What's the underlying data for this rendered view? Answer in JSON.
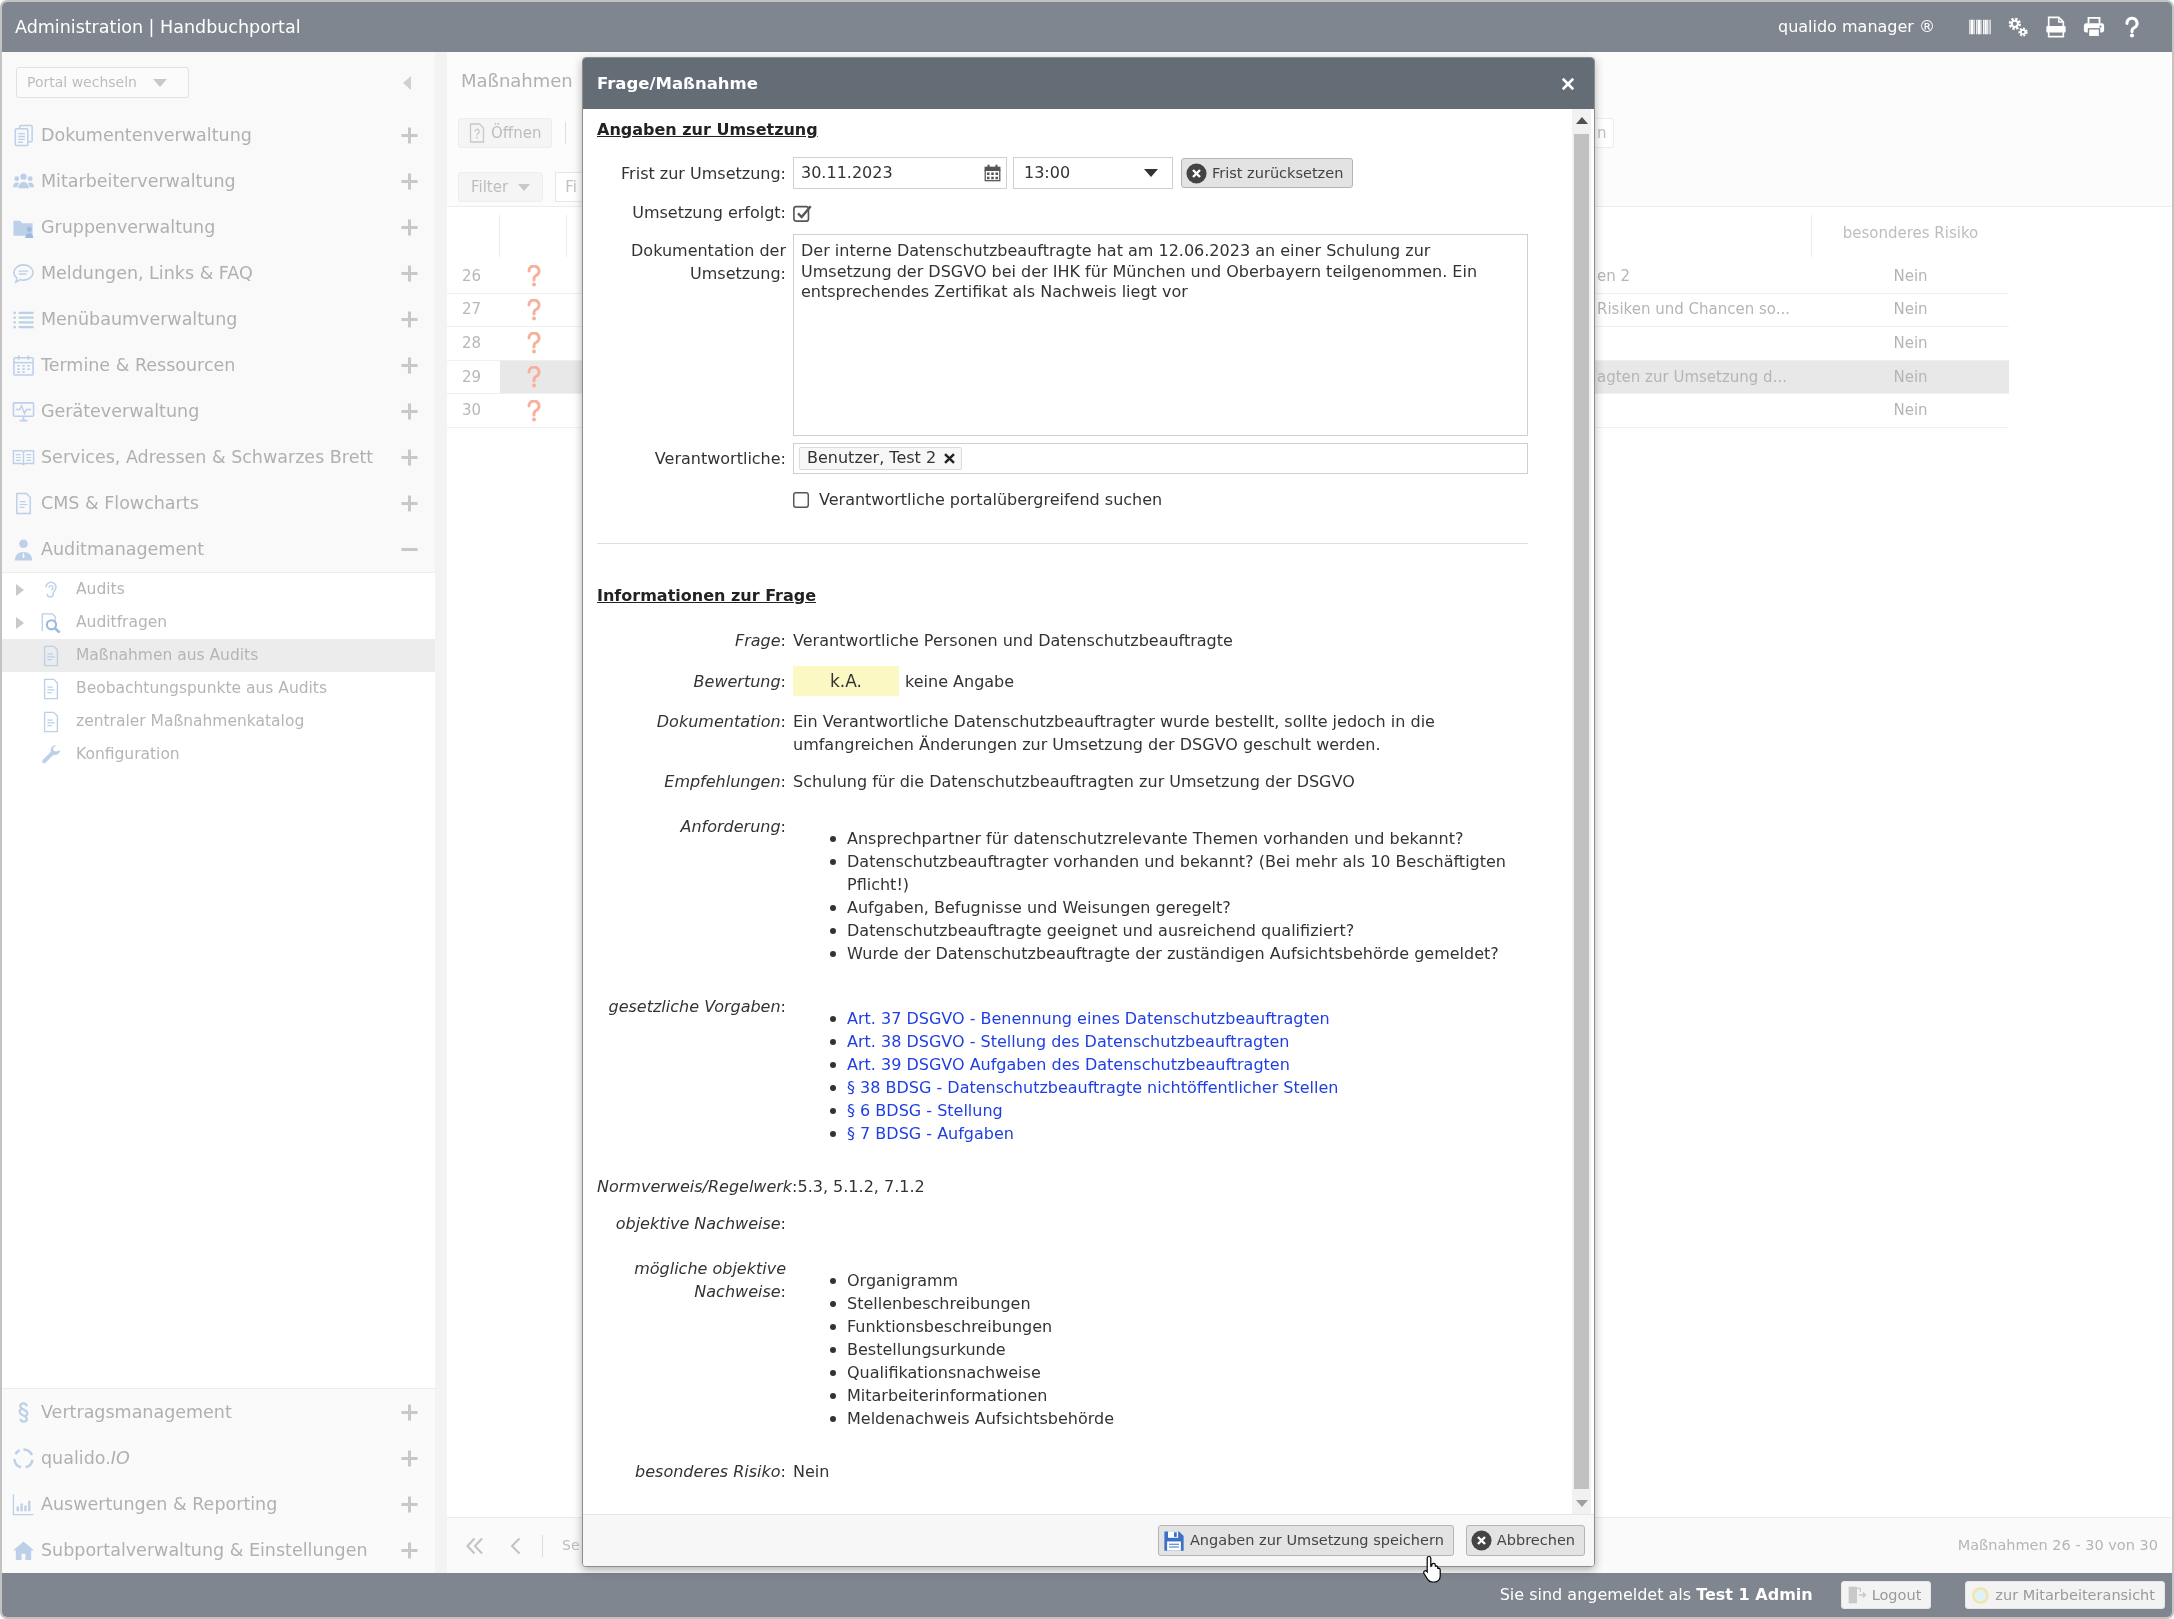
{
  "top_bar": {
    "title": "Administration | Handbuchportal",
    "product": "qualido manager ®"
  },
  "sidebar": {
    "portal_switch": "Portal wechseln",
    "items": [
      {
        "label": "Dokumentenverwaltung",
        "expanded": false
      },
      {
        "label": "Mitarbeiterverwaltung",
        "expanded": false
      },
      {
        "label": "Gruppenverwaltung",
        "expanded": false
      },
      {
        "label": "Meldungen, Links & FAQ",
        "expanded": false
      },
      {
        "label": "Menübaumverwaltung",
        "expanded": false
      },
      {
        "label": "Termine & Ressourcen",
        "expanded": false
      },
      {
        "label": "Geräteverwaltung",
        "expanded": false
      },
      {
        "label": "Services, Adressen & Schwarzes Brett",
        "expanded": false
      },
      {
        "label": "CMS & Flowcharts",
        "expanded": false
      },
      {
        "label": "Auditmanagement",
        "expanded": true,
        "children": [
          {
            "label": "Audits",
            "expanded": false,
            "selected": false
          },
          {
            "label": "Auditfragen",
            "expanded": false,
            "selected": false
          },
          {
            "label": "Maßnahmen aus Audits",
            "selected": true
          },
          {
            "label": "Beobachtungspunkte aus Audits",
            "selected": false
          },
          {
            "label": "zentraler Maßnahmenkatalog",
            "selected": false
          },
          {
            "label": "Konfiguration",
            "selected": false
          }
        ]
      }
    ],
    "bottom_items": [
      {
        "label": "Vertragsmanagement",
        "expanded": false
      },
      {
        "label": "qualido.*IO*",
        "expanded": false
      },
      {
        "label": "Auswertungen & Reporting",
        "expanded": false
      },
      {
        "label": "Subportalverwaltung & Einstellungen",
        "expanded": false
      }
    ]
  },
  "main": {
    "title": "Maßnahmen",
    "toolbar": {
      "open_button": "Öffnen",
      "cut_off_button": "n"
    },
    "filter": {
      "button": "Filter",
      "search_placeholder": "Fi"
    },
    "table": {
      "risk_header": "besonderes Risiko",
      "rows": [
        {
          "number": "26",
          "column_3": "en 2",
          "risk": "Nein",
          "selected": false
        },
        {
          "number": "27",
          "column_3": "Risiken und Chancen so...",
          "risk": "Nein",
          "selected": false
        },
        {
          "number": "28",
          "risk": "Nein",
          "selected": false
        },
        {
          "number": "29",
          "column_3": "agten zur Umsetzung d...",
          "risk": "Nein",
          "selected": true
        },
        {
          "number": "30",
          "risk": "Nein",
          "selected": false
        }
      ]
    },
    "pager": {
      "page_label": "Se",
      "summary": "Maßnahmen 26 - 30 von 30"
    }
  },
  "modal": {
    "title": "Frage/Maßnahme",
    "implementation": {
      "heading": "Angaben zur Umsetzung",
      "deadline_label": "Frist zur Umsetzung:",
      "date": "30.11.2023",
      "time": "13:00",
      "reset_button": "Frist zurücksetzen",
      "done_label": "Umsetzung erfolgt:",
      "done_checked": true,
      "documentation_label": "Dokumentation der Umsetzung:",
      "documentation": "Der interne Datenschutzbeauftragte hat am 12.06.2023 an einer Schulung zur Umsetzung der DSGVO bei der IHK für München und Oberbayern teilgenommen. Ein entsprechendes Zertifikat als Nachweis liegt vor",
      "responsible_label": "Verantwortliche:",
      "responsible": [
        "Benutzer, Test 2"
      ],
      "cross_portal_label": "Verantwortliche portalübergreifend suchen",
      "cross_portal_checked": false
    },
    "question_info": {
      "heading": "Informationen zur Frage",
      "fields": [
        {
          "kind": "text",
          "label": "*Frage*:",
          "value": "Verantwortliche Personen und Datenschutzbeauftragte"
        },
        {
          "kind": "rating",
          "label": "*Bewertung*:",
          "badge": "k.A.",
          "color": "#fcf8c4",
          "value": "keine Angabe"
        },
        {
          "kind": "text",
          "label": "*Dokumentation*:",
          "value": "Ein Verantwortliche Datenschutzbeauftragter wurde bestellt, sollte jedoch in die umfangreichen Änderungen zur Umsetzung der DSGVO geschult werden."
        },
        {
          "kind": "text",
          "label": "*Empfehlungen*:",
          "value": "Schulung für die Datenschutzbeauftragten zur Umsetzung der DSGVO"
        },
        {
          "kind": "list",
          "label": "*Anforderung*:",
          "items": [
            "Ansprechpartner für datenschutzrelevante Themen vorhanden und bekannt?",
            "Datenschutzbeauftragter vorhanden und bekannt? (Bei mehr als 10 Beschäftigten Pflicht!)",
            "Aufgaben, Befugnisse und Weisungen geregelt?",
            "Datenschutzbeauftragte geeignet und ausreichend qualifiziert?",
            "Wurde der Datenschutzbeauftragte der zuständigen Aufsichtsbehörde gemeldet?"
          ]
        },
        {
          "kind": "links",
          "label": "*gesetzliche Vorgaben*:",
          "items": [
            "Art. 37 DSGVO - Benennung eines Datenschutzbeauftragten",
            "Art. 38 DSGVO - Stellung des Datenschutzbeauftragten",
            "Art. 39 DSGVO Aufgaben des Datenschutzbeauftragten",
            "§ 38 BDSG - Datenschutzbeauftragte nichtöffentlicher Stellen",
            "§ 6 BDSG - Stellung",
            "§ 7 BDSG - Aufgaben"
          ]
        },
        {
          "kind": "inline",
          "label": "*Normverweis/Regelwerk*:",
          "value": "5.3, 5.1.2, 7.1.2"
        },
        {
          "kind": "text",
          "label": "*objektive Nachweise*:"
        },
        {
          "kind": "list",
          "label": "*mögliche objektive Nachweise*:",
          "items": [
            "Organigramm",
            "Stellenbeschreibungen",
            "Funktionsbeschreibungen",
            "Bestellungsurkunde",
            "Qualifikationsnachweise",
            "Mitarbeiterinformationen",
            "Meldenachweis Aufsichtsbehörde"
          ]
        },
        {
          "kind": "text",
          "label": "*besonderes Risiko*:",
          "value": "Nein"
        }
      ]
    },
    "buttons": [
      {
        "kind": "save",
        "label": "Angaben zur Umsetzung speichern"
      },
      {
        "kind": "cancel",
        "label": "Abbrechen"
      }
    ]
  },
  "status_bar": {
    "login_text": "Sie sind angemeldet als **Test 1 Admin**",
    "logout": "Logout",
    "employee_view": "zur Mitarbeiteransicht"
  }
}
